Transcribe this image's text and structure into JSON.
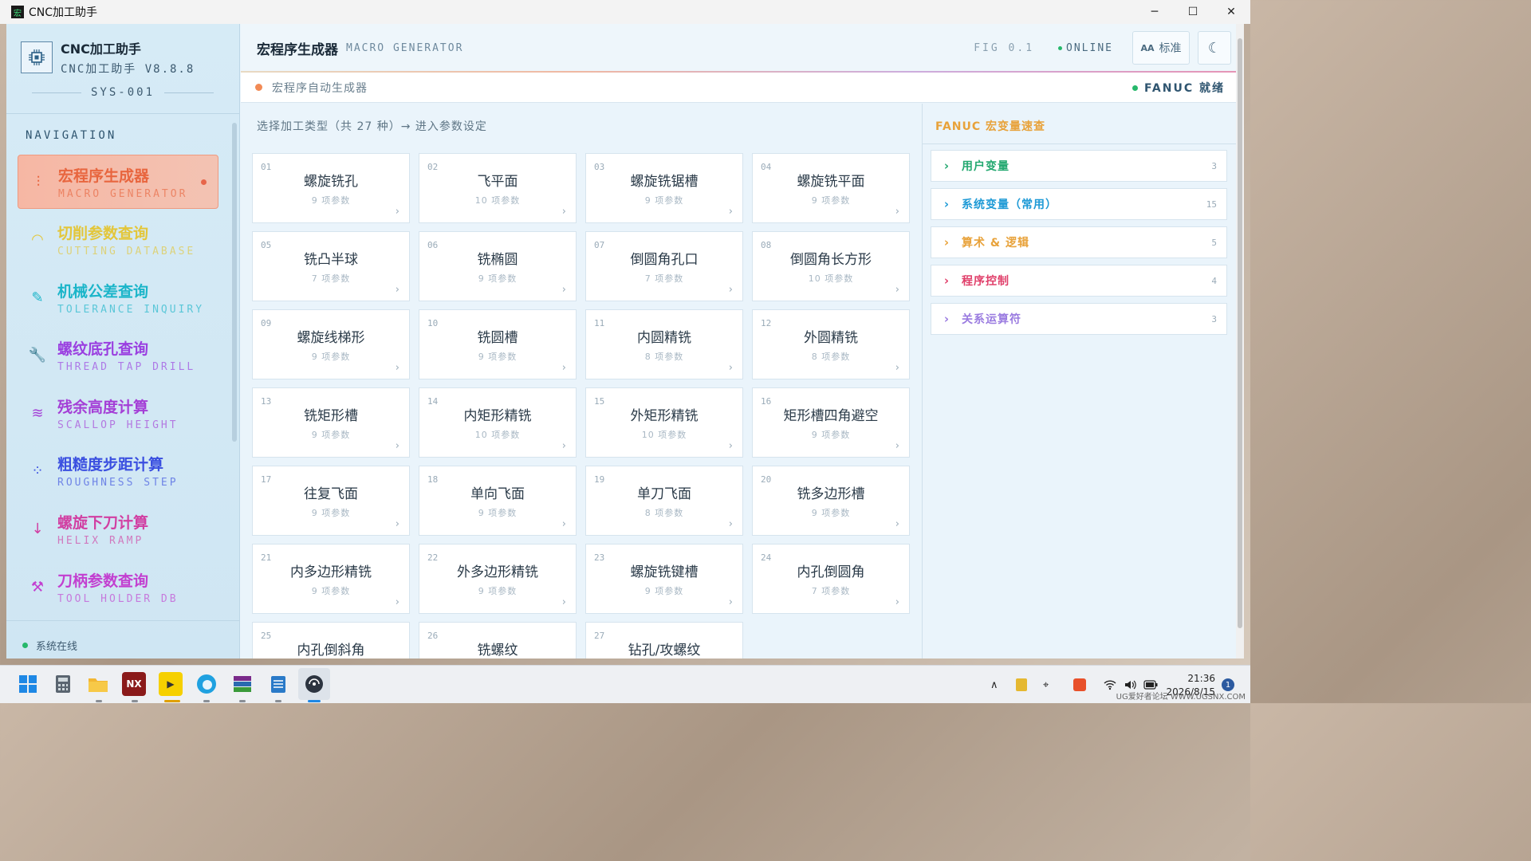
{
  "window": {
    "title": "CNC加工助手",
    "app_icon": "宏",
    "minimize": "─",
    "maximize": "☐",
    "close": "✕"
  },
  "sidebar": {
    "brand_title": "CNC加工助手",
    "brand_version": "CNC加工助手 V8.8.8",
    "sys_id": "SYS-001",
    "nav_label": "NAVIGATION",
    "items": [
      {
        "cn": "宏程序生成器",
        "en": "MACRO GENERATOR",
        "icon": "sliders-icon",
        "glyph": "⫶",
        "color": "#e8663f",
        "active": true
      },
      {
        "cn": "切削参数查询",
        "en": "CUTTING DATABASE",
        "icon": "gauge-icon",
        "glyph": "◠",
        "color": "#e3c63a",
        "active": false
      },
      {
        "cn": "机械公差查询",
        "en": "TOLERANCE INQUIRY",
        "icon": "ruler-icon",
        "glyph": "✎",
        "color": "#1bb5c9",
        "active": false
      },
      {
        "cn": "螺纹底孔查询",
        "en": "THREAD TAP DRILL",
        "icon": "wrench-icon",
        "glyph": "🔧",
        "color": "#9a3fe0",
        "active": false
      },
      {
        "cn": "残余高度计算",
        "en": "SCALLOP HEIGHT",
        "icon": "layers-icon",
        "glyph": "≋",
        "color": "#a43fd6",
        "active": false
      },
      {
        "cn": "粗糙度步距计算",
        "en": "ROUGHNESS STEP",
        "icon": "grid-icon",
        "glyph": "⁘",
        "color": "#3a4fe0",
        "active": false
      },
      {
        "cn": "螺旋下刀计算",
        "en": "HELIX RAMP",
        "icon": "arrow-down-icon",
        "glyph": "↓",
        "color": "#d13fa2",
        "active": false
      },
      {
        "cn": "刀柄参数查询",
        "en": "TOOL HOLDER DB",
        "icon": "tool-icon",
        "glyph": "⚒",
        "color": "#c23fd0",
        "active": false
      }
    ],
    "status": "系统在线"
  },
  "header": {
    "title": "宏程序生成器",
    "subtitle": "MACRO GENERATOR",
    "fig": "FIG 0.1",
    "online": "ONLINE",
    "font_button": "标准",
    "font_icon": "AA",
    "theme_icon": "☾"
  },
  "subbar": {
    "text": "宏程序自动生成器",
    "status": "FANUC 就绪"
  },
  "main": {
    "hint": "选择加工类型（共 27 种）→ 进入参数设定",
    "params_suffix": "项参数",
    "cards": [
      {
        "num": "01",
        "name": "螺旋铣孔",
        "params": "9 项参数"
      },
      {
        "num": "02",
        "name": "飞平面",
        "params": "10 项参数"
      },
      {
        "num": "03",
        "name": "螺旋铣锯槽",
        "params": "9 项参数"
      },
      {
        "num": "04",
        "name": "螺旋铣平面",
        "params": "9 项参数"
      },
      {
        "num": "05",
        "name": "铣凸半球",
        "params": "7 项参数"
      },
      {
        "num": "06",
        "name": "铣椭圆",
        "params": "9 项参数"
      },
      {
        "num": "07",
        "name": "倒圆角孔口",
        "params": "7 项参数"
      },
      {
        "num": "08",
        "name": "倒圆角长方形",
        "params": "10 项参数"
      },
      {
        "num": "09",
        "name": "螺旋线梯形",
        "params": "9 项参数"
      },
      {
        "num": "10",
        "name": "铣圆槽",
        "params": "9 项参数"
      },
      {
        "num": "11",
        "name": "内圆精铣",
        "params": "8 项参数"
      },
      {
        "num": "12",
        "name": "外圆精铣",
        "params": "8 项参数"
      },
      {
        "num": "13",
        "name": "铣矩形槽",
        "params": "9 项参数"
      },
      {
        "num": "14",
        "name": "内矩形精铣",
        "params": "10 项参数"
      },
      {
        "num": "15",
        "name": "外矩形精铣",
        "params": "10 项参数"
      },
      {
        "num": "16",
        "name": "矩形槽四角避空",
        "params": "9 项参数"
      },
      {
        "num": "17",
        "name": "往复飞面",
        "params": "9 项参数"
      },
      {
        "num": "18",
        "name": "单向飞面",
        "params": "9 项参数"
      },
      {
        "num": "19",
        "name": "单刀飞面",
        "params": "8 项参数"
      },
      {
        "num": "20",
        "name": "铣多边形槽",
        "params": "9 项参数"
      },
      {
        "num": "21",
        "name": "内多边形精铣",
        "params": "9 项参数"
      },
      {
        "num": "22",
        "name": "外多边形精铣",
        "params": "9 项参数"
      },
      {
        "num": "23",
        "name": "螺旋铣键槽",
        "params": "9 项参数"
      },
      {
        "num": "24",
        "name": "内孔倒圆角",
        "params": "7 项参数"
      },
      {
        "num": "25",
        "name": "内孔倒斜角",
        "params": ""
      },
      {
        "num": "26",
        "name": "铣螺纹",
        "params": ""
      },
      {
        "num": "27",
        "name": "钻孔/攻螺纹",
        "params": ""
      }
    ]
  },
  "right_panel": {
    "title": "FANUC 宏变量速查",
    "items": [
      {
        "label": "用户变量",
        "count": "3",
        "color": "#23a870"
      },
      {
        "label": "系统变量（常用）",
        "count": "15",
        "color": "#1e9ad6"
      },
      {
        "label": "算术 & 逻辑",
        "count": "5",
        "color": "#e8a23a"
      },
      {
        "label": "程序控制",
        "count": "4",
        "color": "#e03f6a"
      },
      {
        "label": "关系运算符",
        "count": "3",
        "color": "#9a7be0"
      }
    ]
  },
  "taskbar": {
    "nx_label": "NX",
    "time": "21:36",
    "date": "2026/8/15",
    "notifications": "1",
    "watermark": "UG爱好者论坛 WWW.UGSNX.COM"
  }
}
